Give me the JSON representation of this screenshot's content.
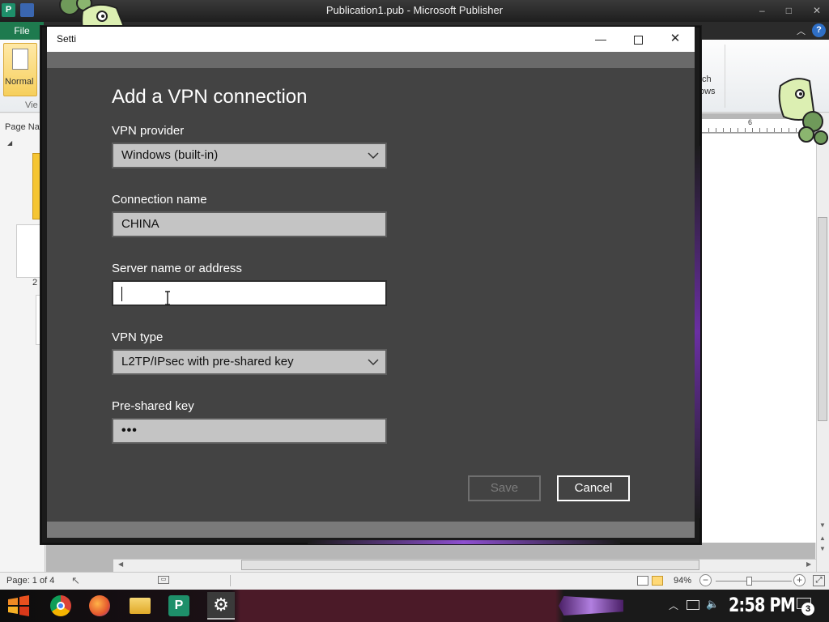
{
  "publisher": {
    "window_title": "Publication1.pub - Microsoft Publisher",
    "file_tab": "File",
    "ribbon": {
      "normal_label": "Normal",
      "view_label": "Vie",
      "switch_label_1": "tch",
      "switch_label_2": "ows"
    },
    "page_nav_title": "Page Nav",
    "thumbnail_number": "2",
    "ruler_number": "6",
    "status": {
      "page": "Page: 1 of 4",
      "zoom": "94%"
    }
  },
  "settings": {
    "window_title": "Setti",
    "heading": "Add a VPN connection",
    "fields": {
      "provider": {
        "label": "VPN provider",
        "value": "Windows (built-in)"
      },
      "connection_name": {
        "label": "Connection name",
        "value": "CHINA"
      },
      "server": {
        "label": "Server name or address",
        "value": ""
      },
      "vpn_type": {
        "label": "VPN type",
        "value": "L2TP/IPsec with pre-shared key"
      },
      "psk": {
        "label": "Pre-shared key",
        "value": "•••"
      }
    },
    "buttons": {
      "save": "Save",
      "cancel": "Cancel"
    }
  },
  "taskbar": {
    "clock": "2:58 PM",
    "notification_count": "3",
    "apps": [
      "chrome-icon",
      "firefox-icon",
      "file-explorer-icon",
      "publisher-icon",
      "settings-icon"
    ]
  },
  "colors": {
    "accent_purple": "#8e4fd0",
    "publisher_green": "#1e8f6a",
    "vpn_panel": "#434343"
  }
}
